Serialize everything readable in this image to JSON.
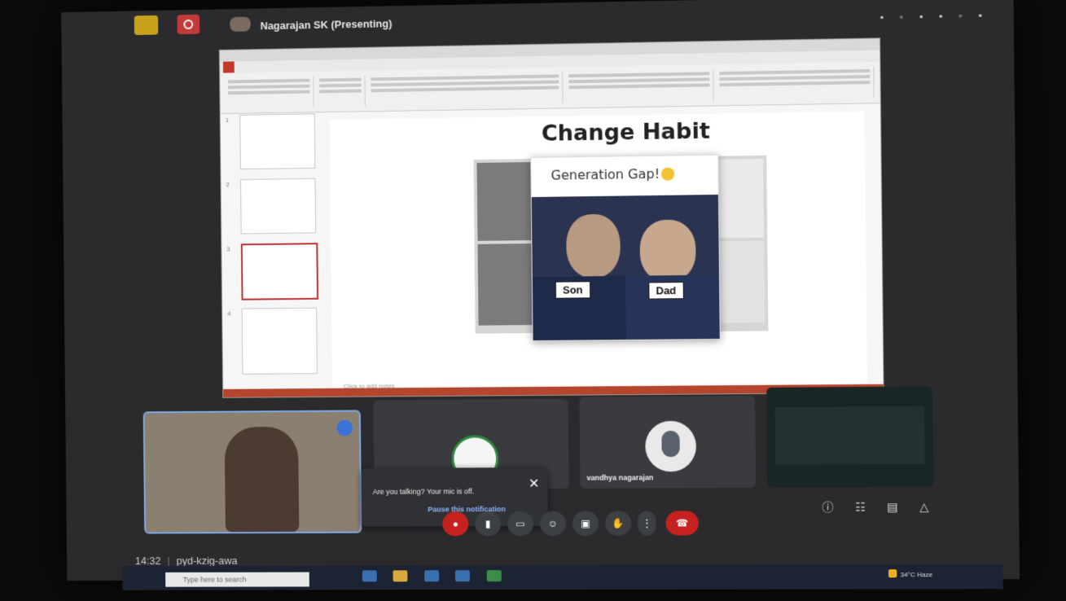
{
  "meet": {
    "presenter_label": "Nagarajan SK (Presenting)",
    "meeting_code": "pyd-kzig-awa",
    "time": "14:32"
  },
  "presentation": {
    "slide_title": "Change Habit",
    "popup_title": "Generation Gap!",
    "labels": {
      "son": "Son",
      "dad": "Dad"
    },
    "notes_placeholder": "Click to add notes"
  },
  "participants": [
    {
      "name": ""
    },
    {
      "name": ""
    },
    {
      "name": "vandhya nagarajan"
    },
    {
      "name": ""
    }
  ],
  "toast": {
    "message": "Are you talking? Your mic is off.",
    "link": "Pause this notification",
    "close": "✕"
  },
  "taskbar": {
    "search_placeholder": "Type here to search",
    "weather": "34°C Haze"
  },
  "icons": {
    "record": "record-icon",
    "mic_off": "mic-off-icon",
    "camera": "camera-icon",
    "captions": "captions-icon",
    "emoji": "emoji-icon",
    "present": "present-icon",
    "hand": "raise-hand-icon",
    "more": "more-icon",
    "hangup": "hangup-icon",
    "info": "info-icon",
    "people": "people-icon",
    "chat": "chat-icon",
    "activities": "activities-icon"
  },
  "colors": {
    "meet_bg": "#2b2b2e",
    "hangup_red": "#c5221f",
    "accent_blue": "#8ab4f8",
    "ppt_status": "#b5452c"
  }
}
